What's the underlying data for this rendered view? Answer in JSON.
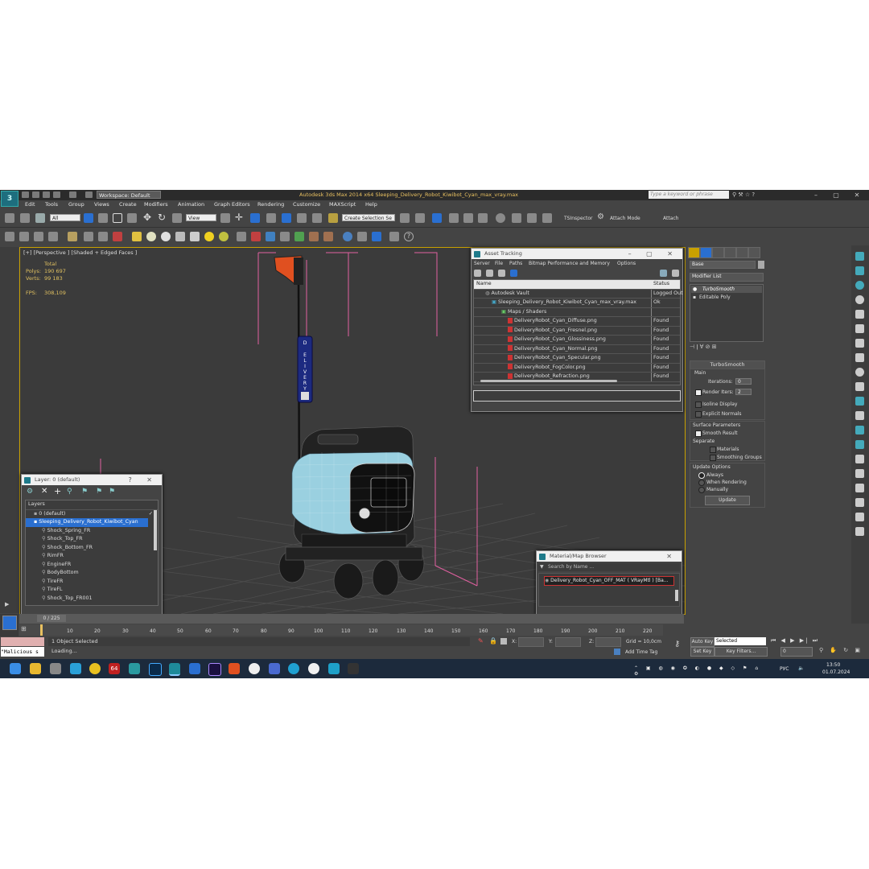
{
  "app": {
    "logo_text": "3",
    "workspace": "Workspace: Default",
    "title": "Autodesk 3ds Max  2014 x64     Sleeping_Delivery_Robot_Kiwibot_Cyan_max_vray.max",
    "search_placeholder": "Type a keyword or phrase"
  },
  "menu": [
    "Edit",
    "Tools",
    "Group",
    "Views",
    "Create",
    "Modifiers",
    "Animation",
    "Graph Editors",
    "Rendering",
    "Customize",
    "MAXScript",
    "Help"
  ],
  "toolbar": {
    "filter": "All",
    "coord": "View",
    "selection_set": "Create Selection Se",
    "ts_inspector": "TSInspector",
    "attach_mode": "Attach Mode",
    "attach": "Attach"
  },
  "viewport": {
    "label": "[+] [Perspective ] [Shaded + Edged Faces ]",
    "stats": {
      "total_label": "Total",
      "polys_label": "Polys:",
      "polys_value": "190 697",
      "verts_label": "Verts:",
      "verts_value": "99 183",
      "fps_label": "FPS:",
      "fps_value": "308,109"
    },
    "sign_text": [
      "D",
      "E",
      "L",
      "I",
      "V",
      "E",
      "R",
      "Y"
    ]
  },
  "asset_tracking": {
    "title": "Asset Tracking",
    "menu": [
      "Server",
      "File",
      "Paths",
      "Bitmap Performance and Memory",
      "Options"
    ],
    "col_name": "Name",
    "col_status": "Status",
    "rows": [
      {
        "name": "Autodesk Vault",
        "status": "Logged Out",
        "indent": 1
      },
      {
        "name": "Sleeping_Delivery_Robot_Kiwibot_Cyan_max_vray.max",
        "status": "Ok",
        "indent": 2
      },
      {
        "name": "Maps / Shaders",
        "status": "",
        "indent": 3
      },
      {
        "name": "DeliveryRobot_Cyan_Diffuse.png",
        "status": "Found",
        "indent": 4
      },
      {
        "name": "DeliveryRobot_Cyan_Fresnel.png",
        "status": "Found",
        "indent": 4
      },
      {
        "name": "DeliveryRobot_Cyan_Glossiness.png",
        "status": "Found",
        "indent": 4
      },
      {
        "name": "DeliveryRobot_Cyan_Normal.png",
        "status": "Found",
        "indent": 4
      },
      {
        "name": "DeliveryRobot_Cyan_Specular.png",
        "status": "Found",
        "indent": 4
      },
      {
        "name": "DeliveryRobot_FogColor.png",
        "status": "Found",
        "indent": 4
      },
      {
        "name": "DeliveryRobot_Refraction.png",
        "status": "Found",
        "indent": 4
      }
    ]
  },
  "layer_window": {
    "title": "Layer: 0 (default)",
    "header": "Layers",
    "rows": [
      {
        "name": "0 (default)",
        "selected": false,
        "indent": 1
      },
      {
        "name": "Sleeping_Delivery_Robot_Kiwibot_Cyan",
        "selected": true,
        "indent": 1
      },
      {
        "name": "Shock_Spring_FR",
        "selected": false,
        "indent": 2
      },
      {
        "name": "Shock_Top_FR",
        "selected": false,
        "indent": 2
      },
      {
        "name": "Shock_Bottom_FR",
        "selected": false,
        "indent": 2
      },
      {
        "name": "RimFR",
        "selected": false,
        "indent": 2
      },
      {
        "name": "EngineFR",
        "selected": false,
        "indent": 2
      },
      {
        "name": "BodyBottom",
        "selected": false,
        "indent": 2
      },
      {
        "name": "TireFR",
        "selected": false,
        "indent": 2
      },
      {
        "name": "TireFL",
        "selected": false,
        "indent": 2
      },
      {
        "name": "Shock_Top_FR001",
        "selected": false,
        "indent": 2
      }
    ]
  },
  "material_browser": {
    "title": "Material/Map Browser",
    "search_placeholder": "Search by Name ...",
    "item": "Delivery_Robot_Cyan_OFF_MAT  ( VRayMtl ) [Ba..."
  },
  "command_panel": {
    "object_name": "Base",
    "modifier_list": "Modifier List",
    "stack": [
      "TurboSmooth",
      "Editable Poly"
    ],
    "turbosmooth": {
      "title": "TurboSmooth",
      "main": "Main",
      "iterations_label": "Iterations:",
      "iterations_value": "0",
      "render_iters_label": "Render Iters:",
      "render_iters_value": "2",
      "isoline": "Isoline Display",
      "explicit_normals": "Explicit Normals",
      "surface_params": "Surface Parameters",
      "smooth_result": "Smooth Result",
      "separate": "Separate",
      "materials": "Materials",
      "smoothing_groups": "Smoothing Groups",
      "update_options": "Update Options",
      "always": "Always",
      "when_rendering": "When Rendering",
      "manually": "Manually",
      "update_button": "Update"
    }
  },
  "timeline": {
    "frame": "0 / 225",
    "ticks": [
      "10",
      "20",
      "30",
      "40",
      "50",
      "60",
      "70",
      "80",
      "90",
      "100",
      "110",
      "120",
      "130",
      "140",
      "150",
      "160",
      "170",
      "180",
      "190",
      "200",
      "210",
      "220"
    ]
  },
  "status": {
    "maxscript": "\"Malicious s",
    "selected": "1 Object Selected",
    "loading": "Loading...",
    "x_label": "X:",
    "y_label": "Y:",
    "z_label": "Z:",
    "grid": "Grid = 10,0cm",
    "add_time_tag": "Add Time Tag",
    "auto_key": "Auto Key",
    "auto_key_value": "Selected",
    "set_key": "Set Key",
    "key_filters": "Key Filters...",
    "frame_value": "0"
  },
  "taskbar": {
    "lang": "РУС",
    "time": "13:50",
    "date": "01.07.2024",
    "badge_64": "64"
  },
  "colors": {
    "title_accent": "#e8c060",
    "viewport_border": "#c8a000",
    "selection": "#2a6fd0",
    "robot_cyan": "#9ad0e0",
    "bbox_pink": "#e060a0"
  }
}
